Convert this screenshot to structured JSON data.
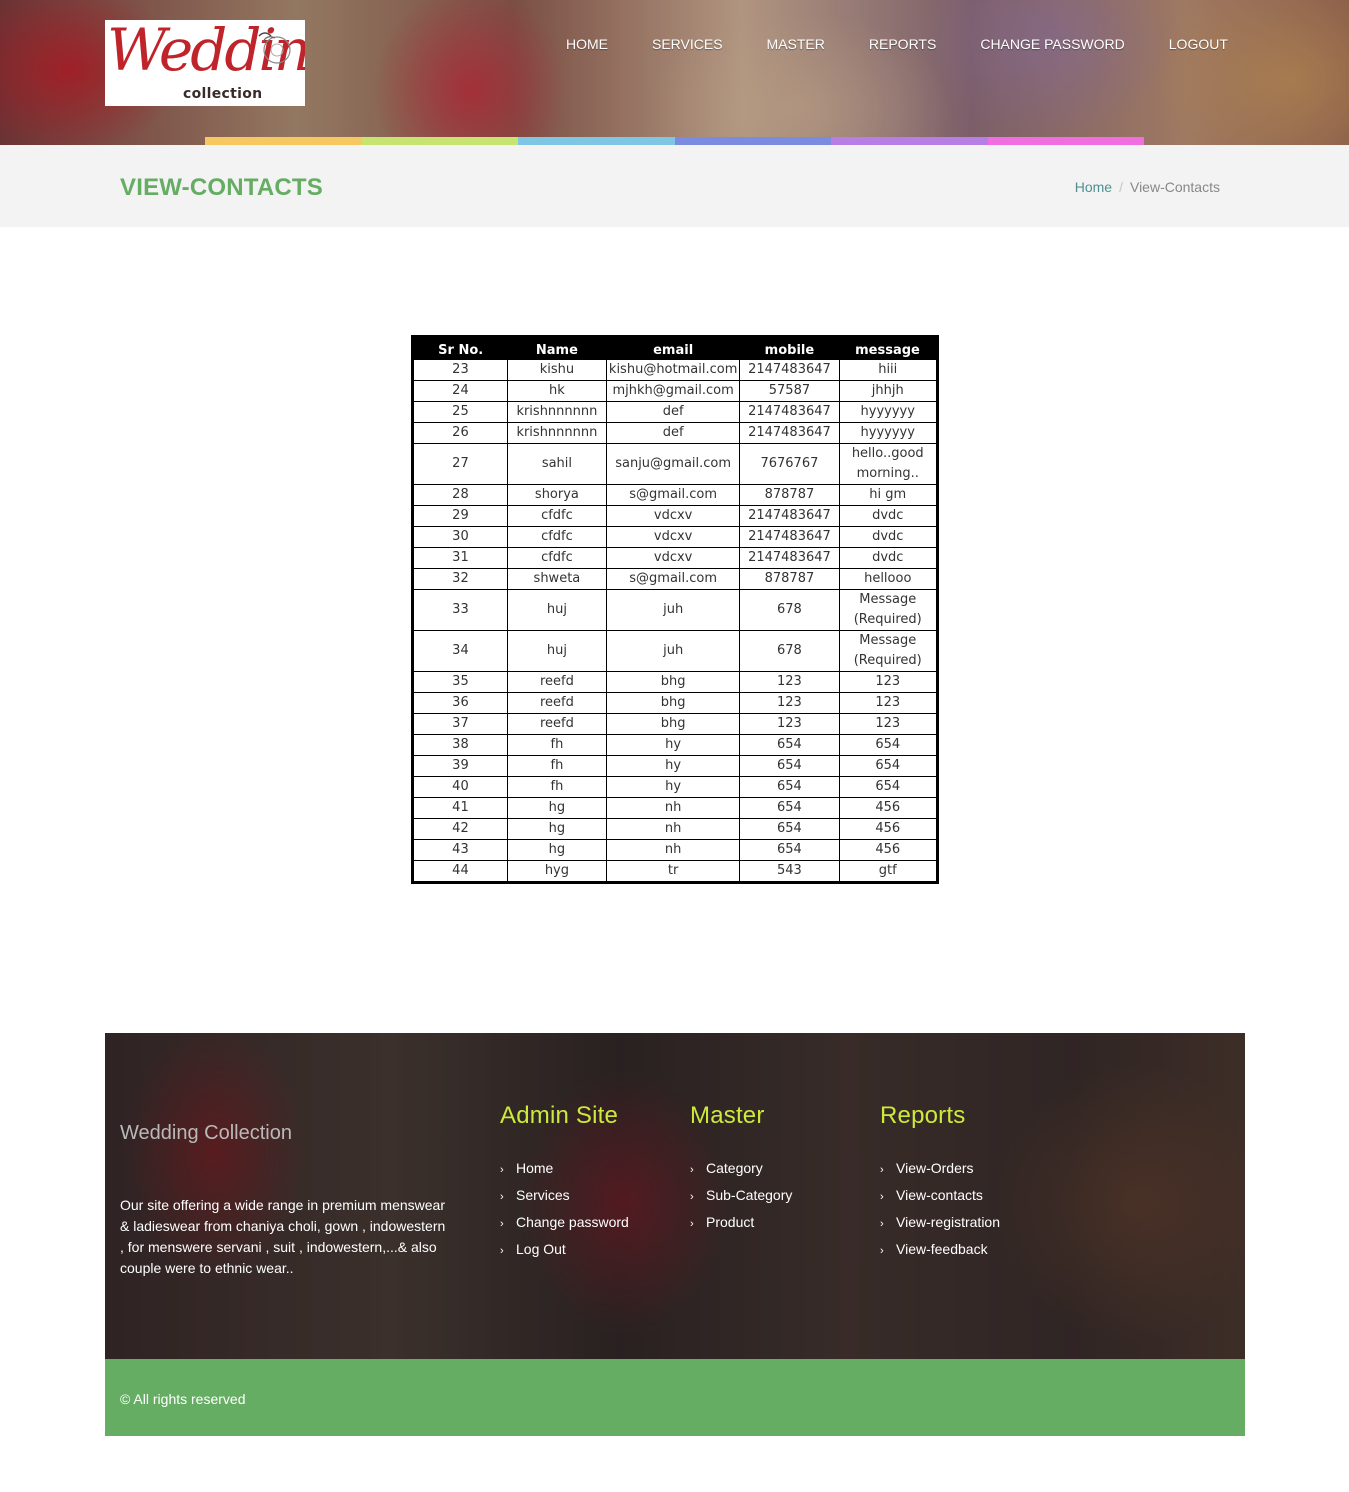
{
  "header": {
    "logo": {
      "script": "Wedding",
      "sub": "collection"
    },
    "nav": [
      "HOME",
      "SERVICES",
      "MASTER",
      "REPORTS",
      "CHANGE PASSWORD",
      "LOGOUT"
    ],
    "color_strip": [
      "#f6c85f",
      "#c7e370",
      "#7fc6e4",
      "#7b8be0",
      "#b77fe6",
      "#f06ee0"
    ]
  },
  "title_bar": {
    "title": "VIEW-CONTACTS",
    "breadcrumb": {
      "home": "Home",
      "separator": "/",
      "current": "View-Contacts"
    }
  },
  "table": {
    "headers": [
      "Sr No.",
      "Name",
      "email",
      "mobile",
      "message"
    ],
    "rows": [
      [
        "23",
        "kishu",
        "kishu@hotmail.com",
        "2147483647",
        "hiii"
      ],
      [
        "24",
        "hk",
        "mjhkh@gmail.com",
        "57587",
        "jhhjh"
      ],
      [
        "25",
        "krishnnnnnn",
        "def",
        "2147483647",
        "hyyyyyy"
      ],
      [
        "26",
        "krishnnnnnn",
        "def",
        "2147483647",
        "hyyyyyy"
      ],
      [
        "27",
        "sahil",
        "sanju@gmail.com",
        "7676767",
        "hello..good morning.."
      ],
      [
        "28",
        "shorya",
        "s@gmail.com",
        "878787",
        "hi gm"
      ],
      [
        "29",
        "cfdfc",
        "vdcxv",
        "2147483647",
        "dvdc"
      ],
      [
        "30",
        "cfdfc",
        "vdcxv",
        "2147483647",
        "dvdc"
      ],
      [
        "31",
        "cfdfc",
        "vdcxv",
        "2147483647",
        "dvdc"
      ],
      [
        "32",
        "shweta",
        "s@gmail.com",
        "878787",
        "hellooo"
      ],
      [
        "33",
        "huj",
        "juh",
        "678",
        "Message (Required)"
      ],
      [
        "34",
        "huj",
        "juh",
        "678",
        "Message (Required)"
      ],
      [
        "35",
        "reefd",
        "bhg",
        "123",
        "123"
      ],
      [
        "36",
        "reefd",
        "bhg",
        "123",
        "123"
      ],
      [
        "37",
        "reefd",
        "bhg",
        "123",
        "123"
      ],
      [
        "38",
        "fh",
        "hy",
        "654",
        "654"
      ],
      [
        "39",
        "fh",
        "hy",
        "654",
        "654"
      ],
      [
        "40",
        "fh",
        "hy",
        "654",
        "654"
      ],
      [
        "41",
        "hg",
        "nh",
        "654",
        "456"
      ],
      [
        "42",
        "hg",
        "nh",
        "654",
        "456"
      ],
      [
        "43",
        "hg",
        "nh",
        "654",
        "456"
      ],
      [
        "44",
        "hyg",
        "tr",
        "543",
        "gtf"
      ]
    ]
  },
  "footer": {
    "brand": "Wedding Collection",
    "about": "Our site offering a wide range in premium menswear & ladieswear from chaniya choli, gown , indowestern , for menswere servani , suit , indowestern,...& also couple were to ethnic wear..",
    "columns": [
      {
        "heading": "Admin Site",
        "links": [
          "Home",
          "Services",
          "Change password",
          "Log Out"
        ]
      },
      {
        "heading": "Master",
        "links": [
          "Category",
          "Sub-Category",
          "Product"
        ]
      },
      {
        "heading": "Reports",
        "links": [
          "View-Orders",
          "View-contacts",
          "View-registration",
          "View-feedback"
        ]
      }
    ],
    "copyright": "© All rights reserved"
  }
}
